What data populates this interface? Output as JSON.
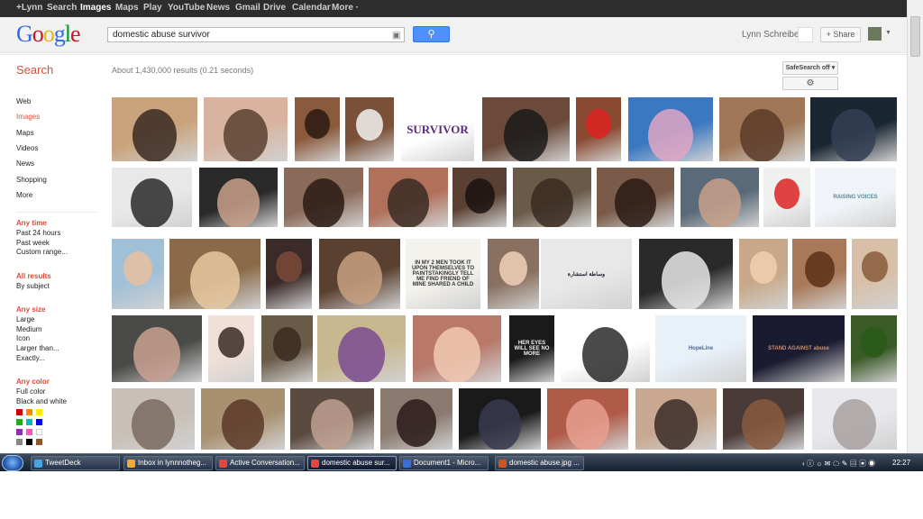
{
  "topbar": {
    "items": [
      "+Lynn",
      "Search",
      "Images",
      "Maps",
      "Play",
      "YouTube",
      "News",
      "Gmail",
      "Drive",
      "Calendar",
      "More ·"
    ]
  },
  "logo": "Google",
  "search": {
    "query": "domestic abuse survivor",
    "button_icon": "search-icon"
  },
  "account": {
    "name": "Lynn Schreiber",
    "share_label": "+ Share"
  },
  "search_label": "Search",
  "results_text": "About 1,430,000 results (0.21 seconds)",
  "safesearch_label": "SafeSearch off ▾",
  "gear_icon": "⚙",
  "sidebar": {
    "nav": [
      "Web",
      "Images",
      "Maps",
      "Videos",
      "News",
      "Shopping",
      "More"
    ],
    "selected": "Images",
    "time": {
      "heading": "Any time",
      "options": [
        "Past 24 hours",
        "Past week",
        "Custom range..."
      ]
    },
    "results": {
      "heading": "All results",
      "options": [
        "By subject"
      ]
    },
    "size": {
      "heading": "Any size",
      "options": [
        "Large",
        "Medium",
        "Icon",
        "Larger than...",
        "Exactly..."
      ]
    },
    "color": {
      "heading": "Any color",
      "options": [
        "Full color",
        "Black and white"
      ],
      "swatches": [
        "#cc0000",
        "#ff8800",
        "#ffee00",
        "#22aa22",
        "#00bbbb",
        "#0000ee",
        "#8833aa",
        "#ff55bb",
        "#ffffff",
        "#888888",
        "#000000",
        "#8b5a2b"
      ]
    }
  },
  "image_overlays": {
    "survivor_text": "SURVIVOR",
    "handwritten": "IN MY 2 MEN TOOK IT UPON THEMSELVES TO PAINTSTAKINGLY TELL ME FIND FRIEND OF MINE SHARED A CHILD",
    "arabic": "وساطة استشارة",
    "her_eyes": "HER EYES WILL SEE NO MORE",
    "stand_against": "STAND AGAINST abuse",
    "raising_voices": "RAISING VOICES",
    "hopeline": "HopeLine"
  },
  "taskbar": {
    "items": [
      {
        "label": "TweetDeck",
        "color": "#4aa3df"
      },
      {
        "label": "Inbox in lynnnotheg...",
        "color": "#f2a93b"
      },
      {
        "label": "Active Conversation...",
        "color": "#e2473b"
      },
      {
        "label": "domestic abuse sur...",
        "color": "#e2473b"
      },
      {
        "label": "Document1 - Micro...",
        "color": "#3a6fd8"
      },
      {
        "label": "domestic abuse.jpg ...",
        "color": "#cc5522"
      }
    ],
    "active_index": 3,
    "tray": "‹ ⓘ ☼ ✉ ☁ ✎  ▤ ▣ ◉",
    "clock": "22:27"
  }
}
